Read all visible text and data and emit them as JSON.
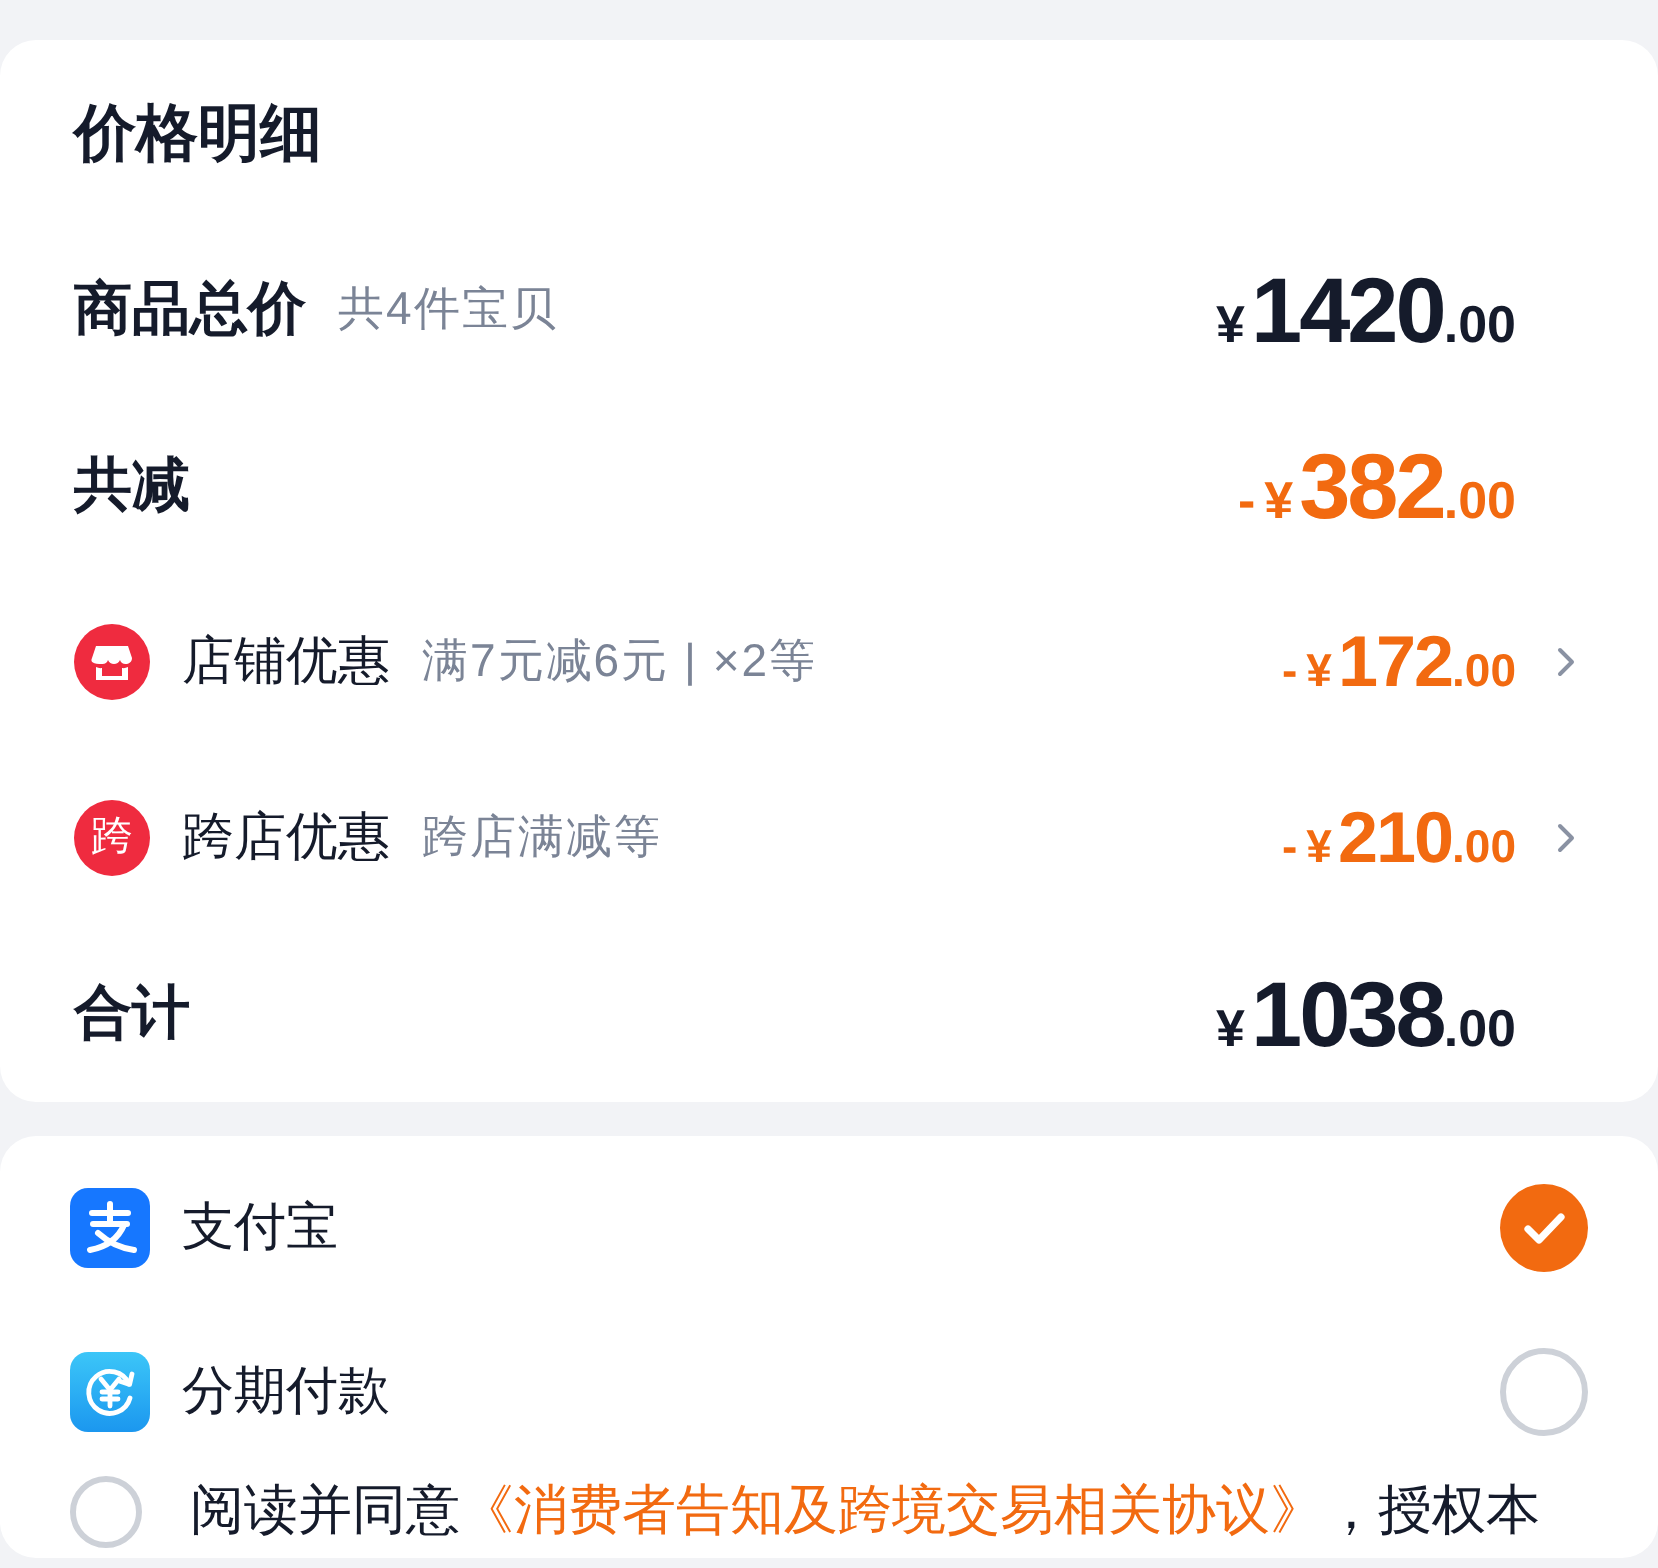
{
  "price_detail": {
    "title": "价格明细",
    "rows": [
      {
        "kind": "subtotal",
        "label": "商品总价",
        "note": "共4件宝贝",
        "price": {
          "currency": "¥",
          "integer": "1420",
          "fraction": ".00"
        }
      },
      {
        "kind": "reduction",
        "label": "共减",
        "price": {
          "sign": "-",
          "currency": "¥",
          "integer": "382",
          "fraction": ".00"
        }
      },
      {
        "kind": "promo",
        "label": "店铺优惠",
        "note": "满7元减6元 | ×2等",
        "price": {
          "sign": "-",
          "currency": "¥",
          "integer": "172",
          "fraction": ".00"
        }
      },
      {
        "kind": "promo",
        "badge": "跨",
        "label": "跨店优惠",
        "note": "跨店满减等",
        "price": {
          "sign": "-",
          "currency": "¥",
          "integer": "210",
          "fraction": ".00"
        }
      },
      {
        "kind": "total",
        "label": "合计",
        "price": {
          "currency": "¥",
          "integer": "1038",
          "fraction": ".00"
        }
      }
    ]
  },
  "payment": {
    "methods": [
      {
        "kind": "direct",
        "label": "支付宝",
        "selected": true
      },
      {
        "kind": "installment",
        "label": "分期付款",
        "selected": false
      }
    ],
    "agreement": {
      "checked": false,
      "text_before": "阅读并同意",
      "link": "《消费者告知及跨境交易相关协议》",
      "text_after": "，授权本"
    }
  }
}
